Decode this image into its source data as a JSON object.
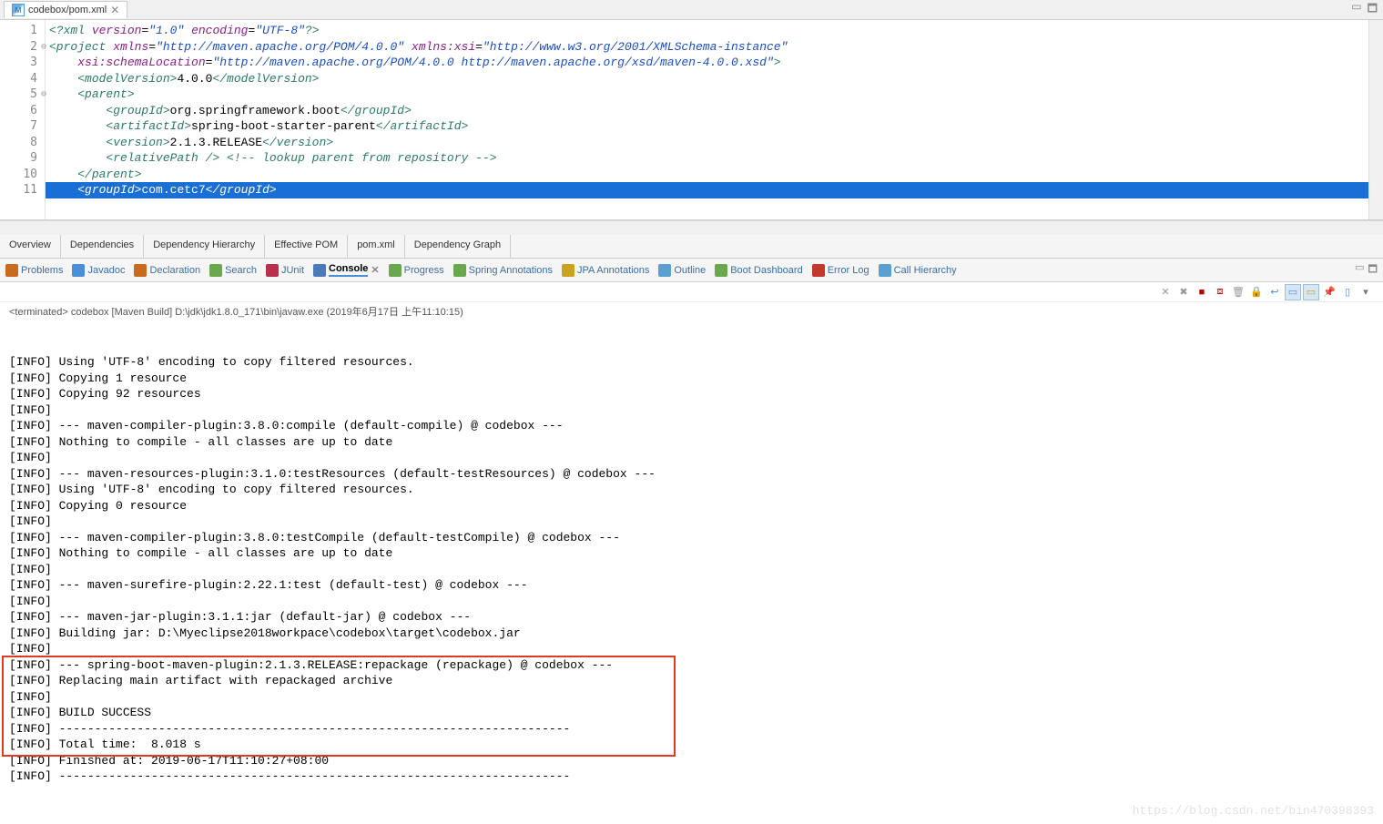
{
  "editor_tab": {
    "title": "codebox/pom.xml"
  },
  "code_lines": [
    {
      "n": "1",
      "html": "<span class='t-proc'>&lt;?xml</span> <span class='t-attr'>version</span><span class='t-txt'>=</span><span class='t-str'>\"1.0\"</span> <span class='t-attr'>encoding</span><span class='t-txt'>=</span><span class='t-str'>\"UTF-8\"</span><span class='t-proc'>?&gt;</span>"
    },
    {
      "n": "2",
      "fold": true,
      "html": "<span class='t-tag'>&lt;project</span> <span class='t-attr'>xmlns</span><span class='t-txt'>=</span><span class='t-str'>\"http://maven.apache.org/POM/4.0.0\"</span> <span class='t-attr'>xmlns:xsi</span><span class='t-txt'>=</span><span class='t-str'>\"http://www.w3.org/2001/XMLSchema-instance\"</span>"
    },
    {
      "n": "3",
      "html": "    <span class='t-attr'>xsi:schemaLocation</span><span class='t-txt'>=</span><span class='t-str'>\"http://maven.apache.org/POM/4.0.0 http://maven.apache.org/xsd/maven-4.0.0.xsd\"</span><span class='t-tag'>&gt;</span>"
    },
    {
      "n": "4",
      "html": "    <span class='t-tag'>&lt;modelVersion&gt;</span><span class='t-txt'>4.0.0</span><span class='t-tag'>&lt;/modelVersion&gt;</span>"
    },
    {
      "n": "5",
      "fold": true,
      "html": "    <span class='t-tag'>&lt;parent&gt;</span>"
    },
    {
      "n": "6",
      "html": "        <span class='t-tag'>&lt;groupId&gt;</span><span class='t-txt'>org.springframework.boot</span><span class='t-tag'>&lt;/groupId&gt;</span>"
    },
    {
      "n": "7",
      "html": "        <span class='t-tag'>&lt;artifactId&gt;</span><span class='t-txt'>spring-boot-starter-parent</span><span class='t-tag'>&lt;/artifactId&gt;</span>"
    },
    {
      "n": "8",
      "html": "        <span class='t-tag'>&lt;version&gt;</span><span class='t-txt'>2.1.3.RELEASE</span><span class='t-tag'>&lt;/version&gt;</span>"
    },
    {
      "n": "9",
      "html": "        <span class='t-tag'>&lt;relativePath /&gt;</span> <span class='t-comm'>&lt;!-- lookup parent from repository --&gt;</span>"
    },
    {
      "n": "10",
      "html": "    <span class='t-tag'>&lt;/parent&gt;</span>"
    },
    {
      "n": "11",
      "selected": true,
      "html": "    <span class='t-tag'>&lt;groupId&gt;</span><span class='t-txt'>com.cetc7</span><span class='t-tag'>&lt;/groupId&gt;</span>"
    }
  ],
  "sub_tabs": [
    "Overview",
    "Dependencies",
    "Dependency Hierarchy",
    "Effective POM",
    "pom.xml",
    "Dependency Graph"
  ],
  "views": [
    {
      "label": "Problems",
      "color": "#c96a1e"
    },
    {
      "label": "Javadoc",
      "color": "#4a90d9"
    },
    {
      "label": "Declaration",
      "color": "#c96a1e"
    },
    {
      "label": "Search",
      "color": "#6aa84f"
    },
    {
      "label": "JUnit",
      "color": "#b8304c"
    },
    {
      "label": "Console",
      "color": "#4a7ab8",
      "active": true
    },
    {
      "label": "Progress",
      "color": "#6aa84f"
    },
    {
      "label": "Spring Annotations",
      "color": "#6aa84f"
    },
    {
      "label": "JPA Annotations",
      "color": "#c9a21e"
    },
    {
      "label": "Outline",
      "color": "#5aa0d0"
    },
    {
      "label": "Boot Dashboard",
      "color": "#6aa84f"
    },
    {
      "label": "Error Log",
      "color": "#c0392b"
    },
    {
      "label": "Call Hierarchy",
      "color": "#5aa0d0"
    }
  ],
  "termination": "<terminated> codebox [Maven Build] D:\\jdk\\jdk1.8.0_171\\bin\\javaw.exe (2019年6月17日 上午11:10:15)",
  "console_lines": [
    "[INFO] Using 'UTF-8' encoding to copy filtered resources.",
    "[INFO] Copying 1 resource",
    "[INFO] Copying 92 resources",
    "[INFO] ",
    "[INFO] --- maven-compiler-plugin:3.8.0:compile (default-compile) @ codebox ---",
    "[INFO] Nothing to compile - all classes are up to date",
    "[INFO] ",
    "[INFO] --- maven-resources-plugin:3.1.0:testResources (default-testResources) @ codebox ---",
    "[INFO] Using 'UTF-8' encoding to copy filtered resources.",
    "[INFO] Copying 0 resource",
    "[INFO] ",
    "[INFO] --- maven-compiler-plugin:3.8.0:testCompile (default-testCompile) @ codebox ---",
    "[INFO] Nothing to compile - all classes are up to date",
    "[INFO] ",
    "[INFO] --- maven-surefire-plugin:2.22.1:test (default-test) @ codebox ---",
    "[INFO] ",
    "[INFO] --- maven-jar-plugin:3.1.1:jar (default-jar) @ codebox ---",
    "[INFO] Building jar: D:\\Myeclipse2018workpace\\codebox\\target\\codebox.jar",
    "[INFO] ",
    "[INFO] --- spring-boot-maven-plugin:2.1.3.RELEASE:repackage (repackage) @ codebox ---",
    "[INFO] Replacing main artifact with repackaged archive",
    "[INFO] ",
    "[INFO] BUILD SUCCESS",
    "[INFO] ------------------------------------------------------------------------",
    "[INFO] Total time:  8.018 s",
    "[INFO] Finished at: 2019-06-17T11:10:27+08:00",
    "[INFO] ------------------------------------------------------------------------"
  ],
  "highlight_range": {
    "from": 21,
    "to": 26
  },
  "toolbar_icons": [
    {
      "name": "remove-launch-icon",
      "glyph": "✕",
      "color": "#999"
    },
    {
      "name": "remove-all-icon",
      "glyph": "✖",
      "color": "#999"
    },
    {
      "name": "terminate-icon",
      "glyph": "■",
      "color": "#b00"
    },
    {
      "name": "terminate-all-icon",
      "glyph": "⧈",
      "color": "#b00"
    },
    {
      "name": "clear-console-icon",
      "glyph": "🗑",
      "color": "#999"
    },
    {
      "name": "scroll-lock-icon",
      "glyph": "🔒",
      "color": "#c9a21e"
    },
    {
      "name": "word-wrap-icon",
      "glyph": "↩",
      "color": "#4a90d9"
    },
    {
      "name": "show-console-icon",
      "glyph": "▭",
      "color": "#4a90d9",
      "active": true
    },
    {
      "name": "show-standard-icon",
      "glyph": "▭",
      "color": "#c9a21e",
      "active": true
    },
    {
      "name": "pin-console-icon",
      "glyph": "📌",
      "color": "#777"
    },
    {
      "name": "display-icon",
      "glyph": "▯",
      "color": "#4a90d9"
    },
    {
      "name": "open-console-icon",
      "glyph": "▾",
      "color": "#777"
    }
  ],
  "watermark": "https://blog.csdn.net/bin470398393"
}
